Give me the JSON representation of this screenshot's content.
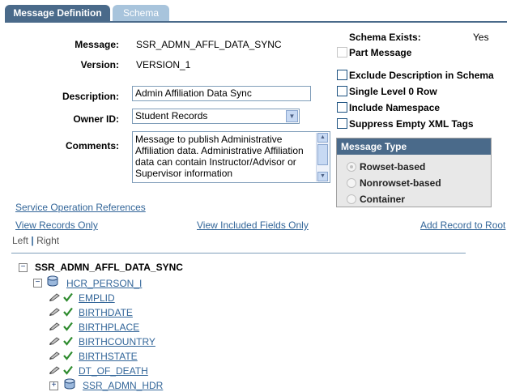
{
  "tabs": [
    {
      "label": "Message Definition",
      "active": true
    },
    {
      "label": "Schema",
      "active": false
    }
  ],
  "form": {
    "message_label": "Message:",
    "message_value": "SSR_ADMN_AFFL_DATA_SYNC",
    "version_label": "Version:",
    "version_value": "VERSION_1",
    "description_label": "Description:",
    "description_value": "Admin Affiliation Data Sync",
    "owner_label": "Owner ID:",
    "owner_value": "Student Records",
    "comments_label": "Comments:",
    "comments_value": "Message to publish Administrative Affiliation data. Administrative Affiliation data can contain Instructor/Advisor or Supervisor information"
  },
  "schema": {
    "exists_label": "Schema Exists:",
    "exists_value": "Yes"
  },
  "options": {
    "part_message": "Part Message",
    "exclude_description": "Exclude Description in Schema",
    "single_level": "Single Level 0 Row",
    "include_namespace": "Include Namespace",
    "suppress_empty": "Suppress Empty XML Tags"
  },
  "message_type": {
    "title": "Message Type",
    "options": [
      "Rowset-based",
      "Nonrowset-based",
      "Container"
    ],
    "selected": "Rowset-based"
  },
  "links": {
    "service_refs": "Service Operation References",
    "view_records": "View Records Only",
    "view_fields": "View Included Fields Only",
    "add_record": "Add Record to Root"
  },
  "tree_nav": {
    "left": "Left",
    "sep": "|",
    "right": "Right"
  },
  "tree": {
    "root": "SSR_ADMN_AFFL_DATA_SYNC",
    "record": "HCR_PERSON_I",
    "fields": [
      "EMPLID",
      "BIRTHDATE",
      "BIRTHPLACE",
      "BIRTHCOUNTRY",
      "BIRTHSTATE",
      "DT_OF_DEATH"
    ],
    "child_record": "SSR_ADMN_HDR"
  },
  "colors": {
    "tab_active": "#4a6a8a",
    "tab_inactive": "#a8c4dc",
    "link": "#336699",
    "check": "#2e8b2e"
  }
}
